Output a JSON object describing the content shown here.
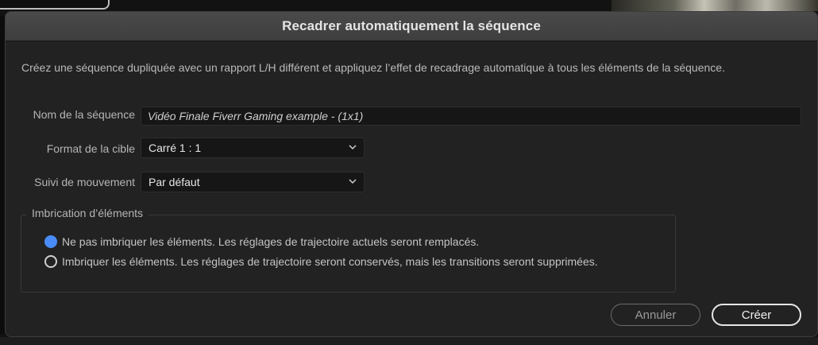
{
  "dialog": {
    "title": "Recadrer automatiquement la séquence",
    "description": "Créez une séquence dupliquée avec un rapport L/H différent et appliquez l’effet de recadrage automatique à tous les éléments de la séquence."
  },
  "fields": {
    "sequence_name_label": "Nom de la séquence",
    "sequence_name_value": "Vidéo Finale Fiverr Gaming example - (1x1)",
    "target_format_label": "Format de la cible",
    "target_format_value": "Carré 1 : 1",
    "motion_tracking_label": "Suivi de mouvement",
    "motion_tracking_value": "Par défaut"
  },
  "nesting": {
    "legend": "Imbrication d’éléments",
    "options": [
      {
        "label": "Ne pas imbriquer les éléments. Les réglages de trajectoire actuels seront remplacés.",
        "selected": true
      },
      {
        "label": "Imbriquer les éléments. Les réglages de trajectoire seront conservés, mais les transitions seront supprimées.",
        "selected": false
      }
    ]
  },
  "buttons": {
    "cancel": "Annuler",
    "create": "Créer"
  },
  "colors": {
    "accent": "#4a8cf7",
    "dialog_bg": "#222222",
    "title_bar": "#444444"
  }
}
